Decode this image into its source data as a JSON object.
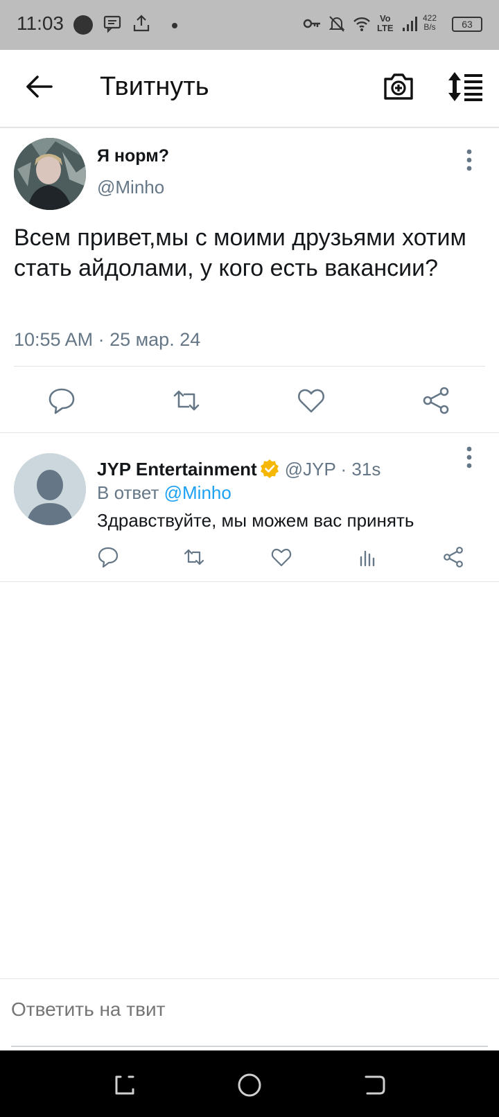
{
  "status_bar": {
    "time": "11:03",
    "net_speed_value": "422",
    "net_speed_unit": "B/s",
    "battery": "63",
    "network_label_top": "Vo",
    "network_label_bottom": "LTE"
  },
  "header": {
    "title": "Твитнуть"
  },
  "main_tweet": {
    "display_name": "Я норм?",
    "handle": "@Minho",
    "text": "Всем привет,мы с моими друзьями хотим стать айдолами, у кого есть вакансии?",
    "meta": "10:55 AM · 25 мар. 24"
  },
  "reply": {
    "display_name": "JYP Entertainment",
    "handle": "@JYP",
    "separator": " · ",
    "time": "31s",
    "in_reply_prefix": "В ответ",
    "mention": "@Minho",
    "text": "Здравствуйте, мы можем вас принять",
    "verified_color": "#f5b700"
  },
  "compose": {
    "placeholder": "Ответить на твит"
  },
  "colors": {
    "accent": "#1da1f2",
    "secondary_text": "#657786",
    "status_bar_bg": "#bdbdbd",
    "nav_bar_bg": "#000000"
  }
}
